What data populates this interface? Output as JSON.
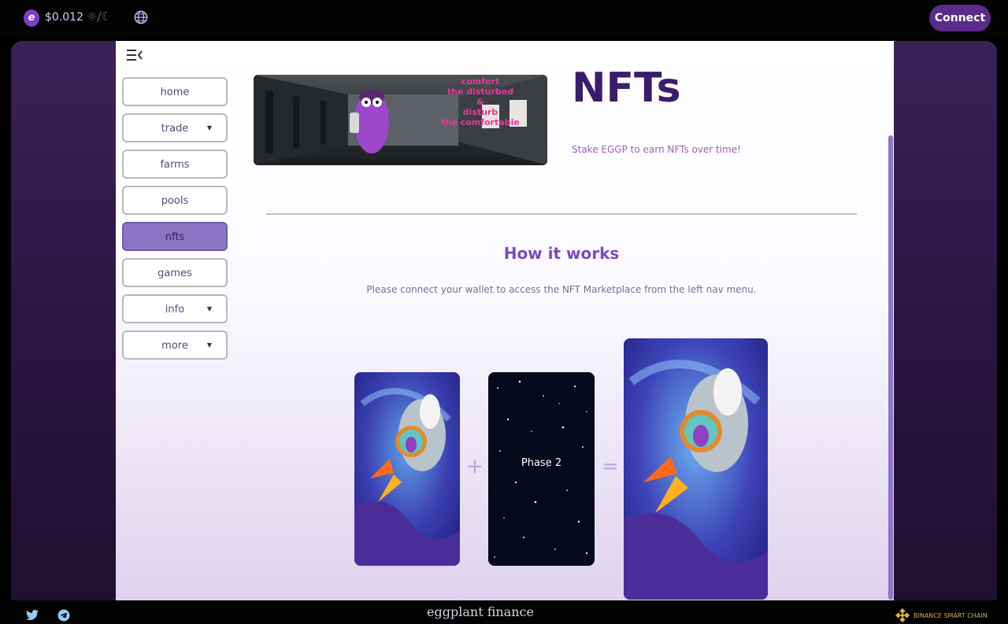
{
  "header": {
    "price_icon": "eggplant-coin-icon",
    "price": "$0.012",
    "theme_toggle": "☼/☾",
    "language_icon": "globe-icon",
    "connect_label": "Connect"
  },
  "sidebar": {
    "items": [
      {
        "label": "home",
        "has_dropdown": false,
        "active": false
      },
      {
        "label": "trade",
        "has_dropdown": true,
        "active": false
      },
      {
        "label": "farms",
        "has_dropdown": false,
        "active": false
      },
      {
        "label": "pools",
        "has_dropdown": false,
        "active": false
      },
      {
        "label": "nfts",
        "has_dropdown": false,
        "active": true
      },
      {
        "label": "games",
        "has_dropdown": false,
        "active": false
      },
      {
        "label": "info",
        "has_dropdown": true,
        "active": false
      },
      {
        "label": "more",
        "has_dropdown": true,
        "active": false
      }
    ]
  },
  "main": {
    "title": "NFTs",
    "subtitle": "Stake EGGP to earn NFTs over time!",
    "banner_text": [
      "comfort",
      "the disturbed",
      "&",
      "disturb",
      "the comfortable"
    ],
    "how_title": "How it works",
    "connect_message": "Please connect your wallet to access the NFT Marketplace from the left nav menu.",
    "phase_label": "Phase 2",
    "plus": "+",
    "equals": "="
  },
  "footer": {
    "brand": "eggplant finance",
    "chain": "BINANCE SMART CHAIN",
    "social": [
      "twitter-icon",
      "telegram-icon"
    ]
  },
  "colors": {
    "accent": "#5a2b8a",
    "title": "#3a1d6a",
    "active_nav": "#8b76c6",
    "background": "#000000"
  }
}
